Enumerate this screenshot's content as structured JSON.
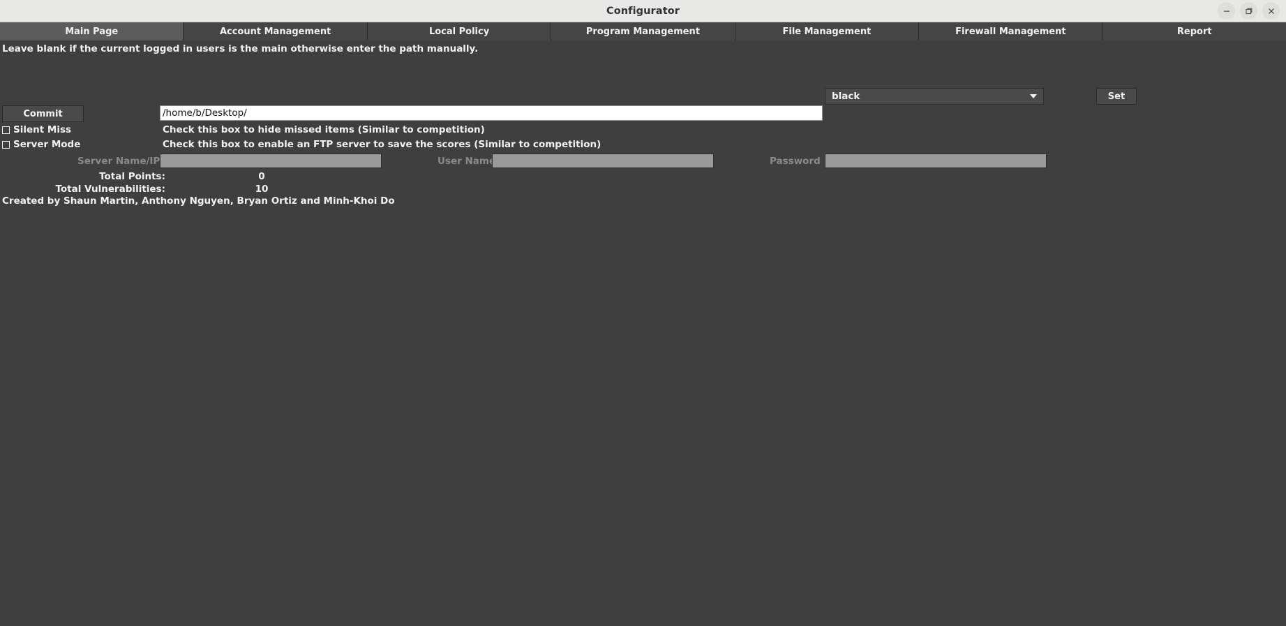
{
  "window": {
    "title": "Configurator",
    "controls": {
      "minimize": "minimize-button",
      "maximize": "maximize-button",
      "close": "close-button"
    }
  },
  "tabs": [
    {
      "label": "Main Page",
      "selected": true
    },
    {
      "label": "Account Management",
      "selected": false
    },
    {
      "label": "Local Policy",
      "selected": false
    },
    {
      "label": "Program Management",
      "selected": false
    },
    {
      "label": "File Management",
      "selected": false
    },
    {
      "label": "Firewall Management",
      "selected": false
    },
    {
      "label": "Report",
      "selected": false
    }
  ],
  "main": {
    "hint": "Leave blank if the current logged in users is the main otherwise enter the path manually.",
    "theme": {
      "selected": "black",
      "options": [
        "black"
      ],
      "set_label": "Set"
    },
    "commit_label": "Commit",
    "path": {
      "value": "/home/b/Desktop/",
      "placeholder": ""
    },
    "checkboxes": [
      {
        "label": "Silent Miss",
        "description": "Check this box to hide missed items (Similar to competition)",
        "checked": false
      },
      {
        "label": "Server Mode",
        "description": "Check this box to enable an FTP server to save the scores (Similar to competition)",
        "checked": false
      }
    ],
    "ftp": {
      "server_label": "Server Name/IP",
      "server_value": "",
      "user_label": "User Name",
      "user_value": "",
      "password_label": "Password",
      "password_value": ""
    },
    "stats": [
      {
        "label": "Total Points:",
        "value": "0"
      },
      {
        "label": "Total Vulnerabilities:",
        "value": "10"
      }
    ],
    "credits": "Created by Shaun Martin, Anthony Nguyen, Bryan Ortiz and Minh-Khoi Do"
  }
}
